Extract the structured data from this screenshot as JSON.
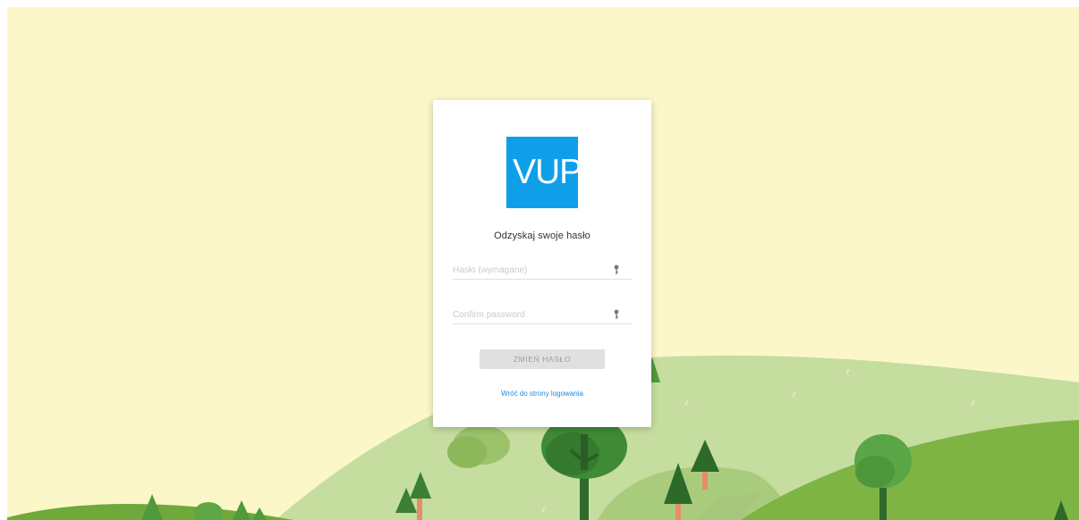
{
  "logo": {
    "text": "VUP",
    "color": "#0f9fe8"
  },
  "form": {
    "title": "Odzyskaj swoje hasło",
    "password_placeholder": "Hasło (wymagane)",
    "confirm_placeholder": "Confirm password",
    "submit_label": "ZMIEŃ HASŁO",
    "back_link_label": "Wróć do strony logowania"
  },
  "icons": {
    "password": "key-icon",
    "confirm": "key-icon"
  },
  "colors": {
    "background": "#fbf7c8",
    "hill_light": "#c6dfa0",
    "hill_dark": "#7cb342",
    "tree_dark": "#2e6b2a",
    "link": "#1e8ad6"
  }
}
